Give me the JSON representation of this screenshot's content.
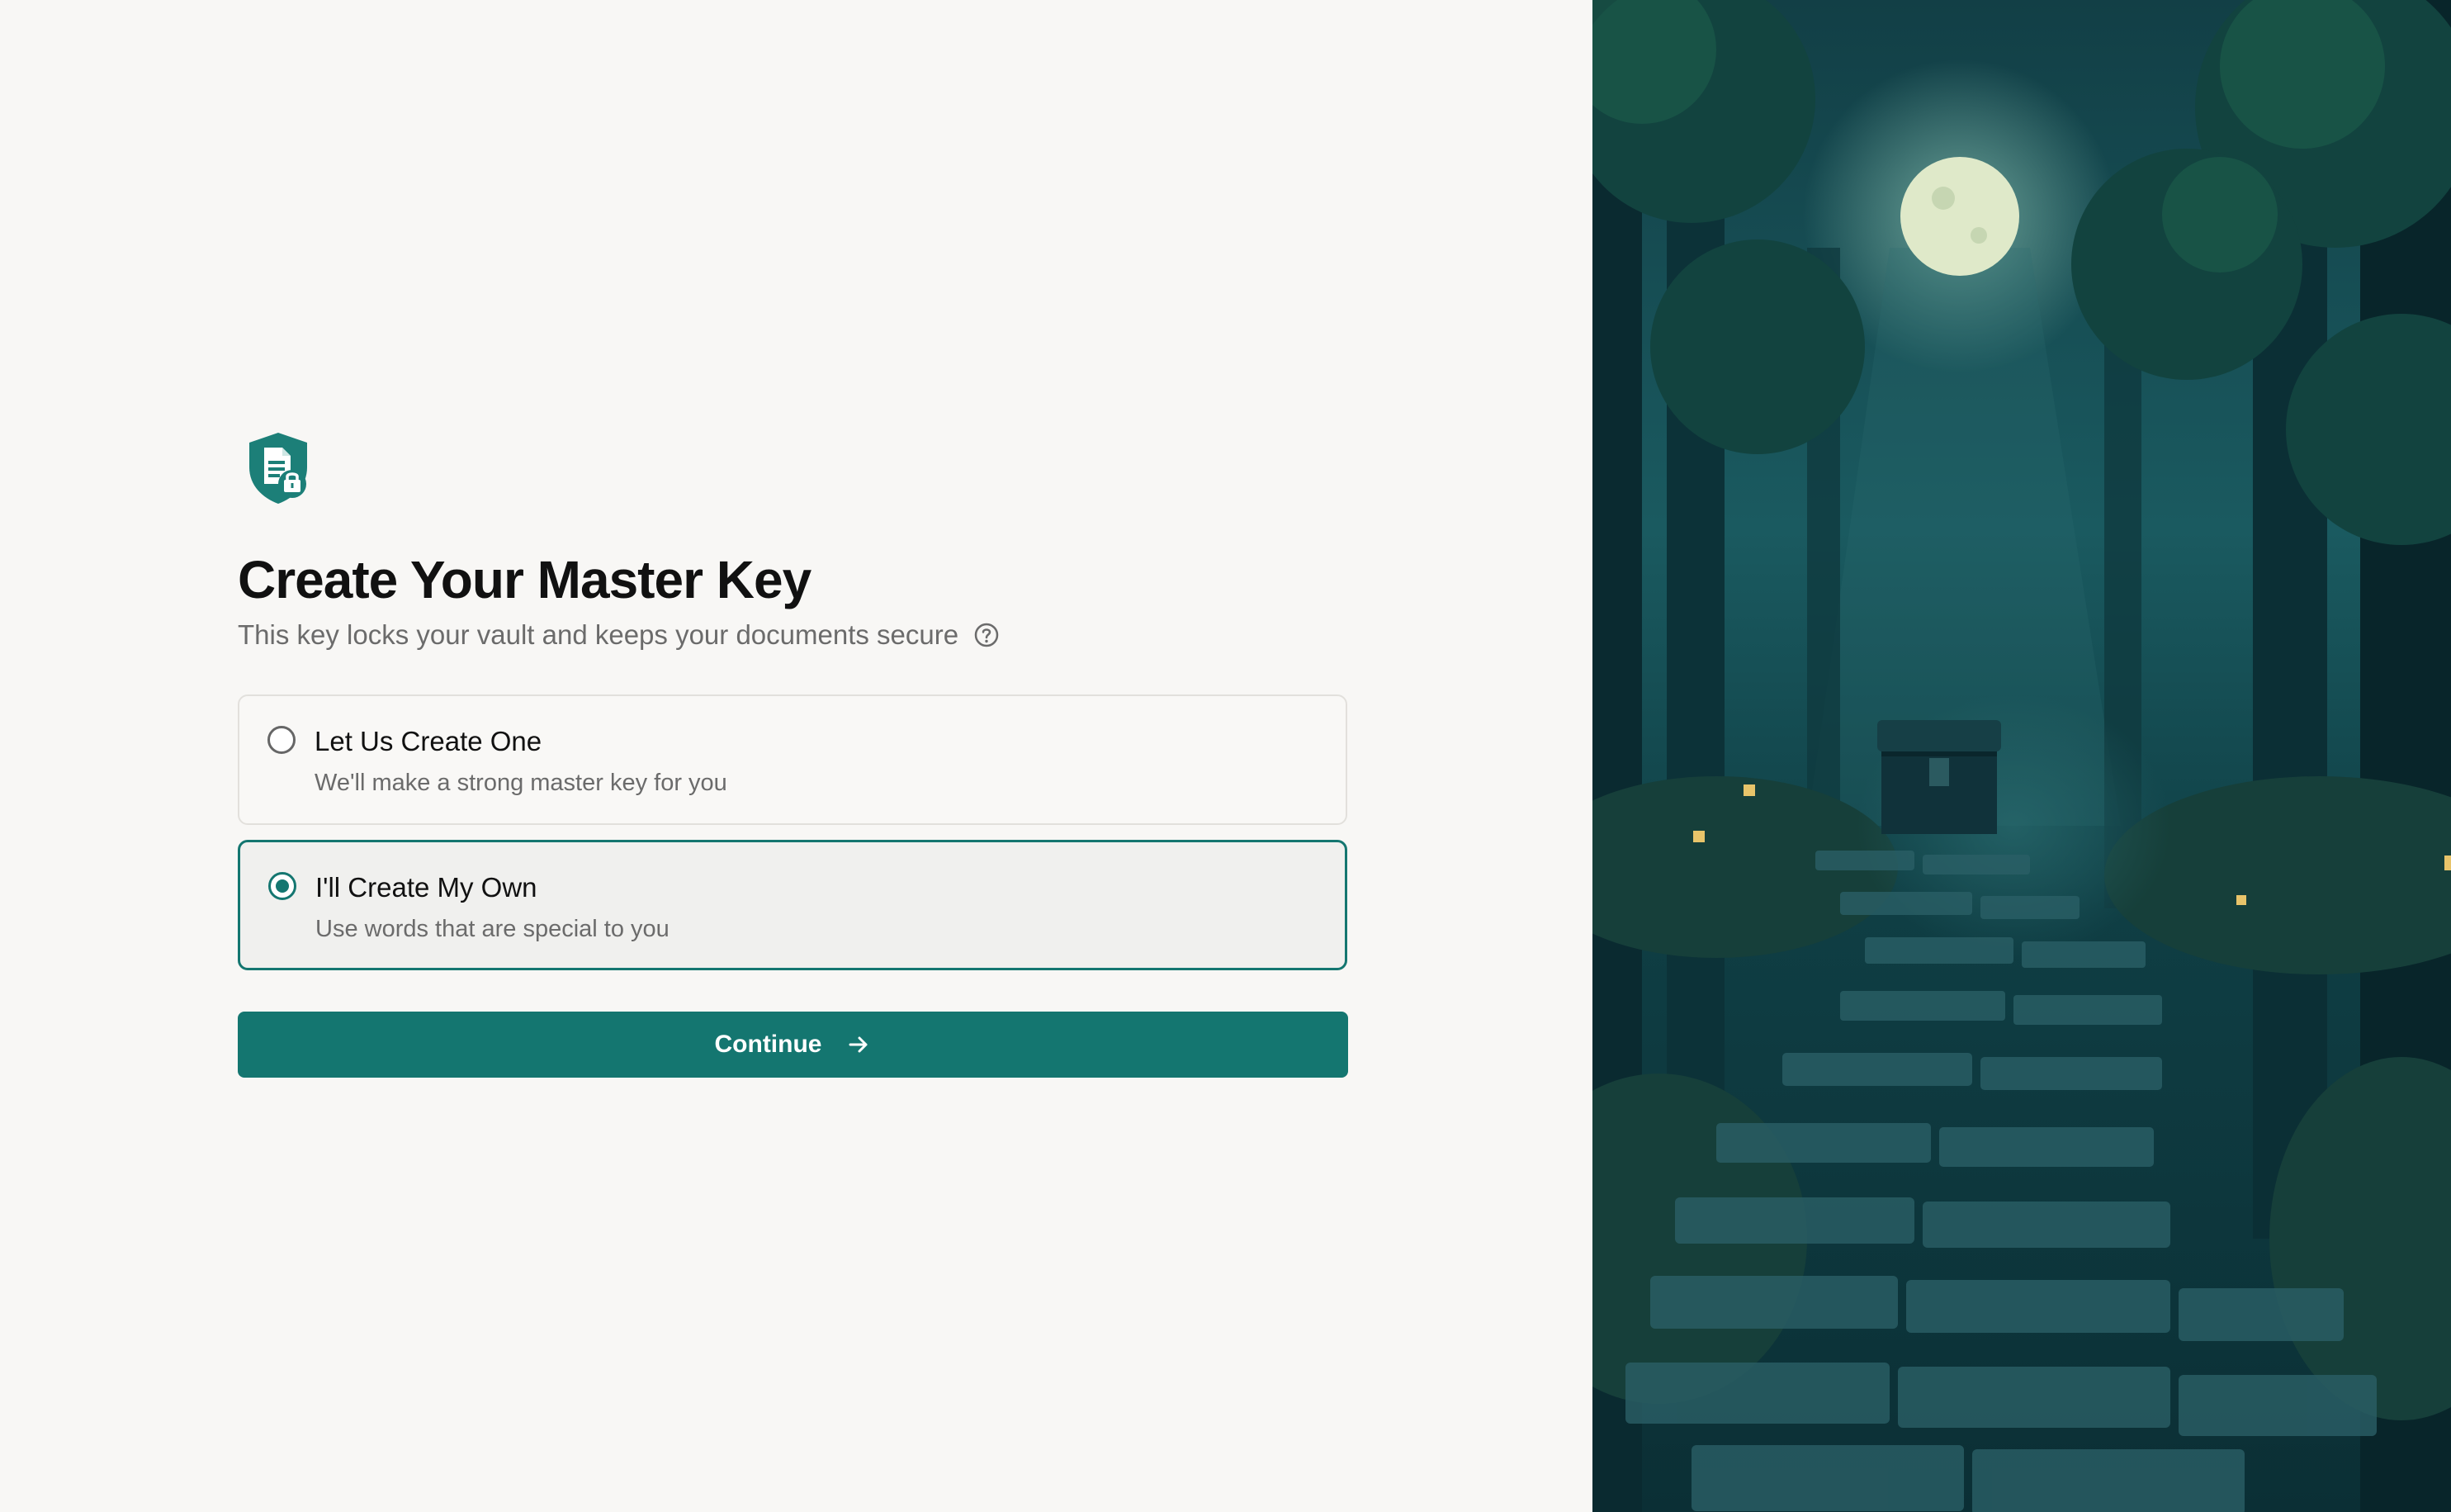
{
  "header": {
    "logo_icon": "shield-document-lock-icon",
    "title": "Create Your Master Key",
    "subtitle": "This key locks your vault and keeps your documents secure",
    "help_icon": "question-circle-icon"
  },
  "options": [
    {
      "title": "Let Us Create One",
      "description": "We'll make a strong master key for you",
      "selected": false
    },
    {
      "title": "I'll Create My Own",
      "description": "Use words that are special to you",
      "selected": true
    }
  ],
  "continue_button": {
    "label": "Continue",
    "icon": "arrow-right-icon"
  },
  "colors": {
    "accent": "#147670",
    "background": "#f8f7f5",
    "text_primary": "#111111",
    "text_secondary": "#6b6b6b"
  },
  "illustration": {
    "subject": "pixel-art-forest-moon-treasure-chest"
  }
}
